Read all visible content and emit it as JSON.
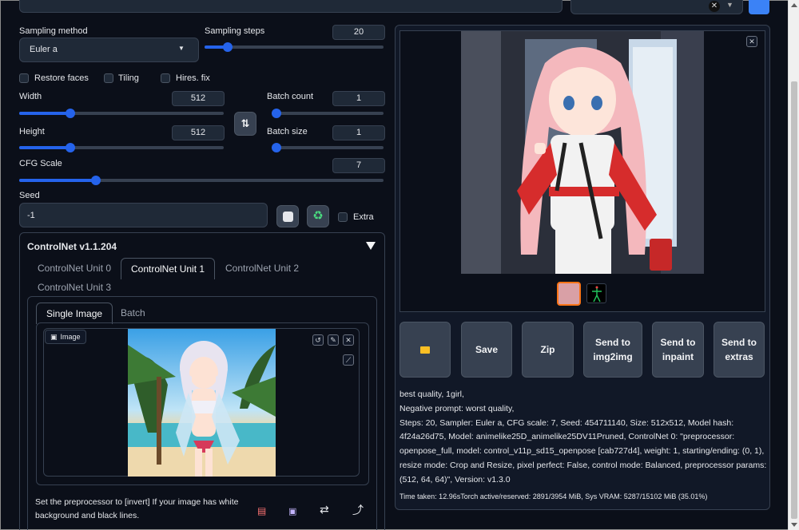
{
  "sampling": {
    "method_label": "Sampling method",
    "method_value": "Euler a",
    "steps_label": "Sampling steps",
    "steps_value": "20",
    "steps_fraction": 0.13
  },
  "checkboxes": {
    "restore_faces": "Restore faces",
    "tiling": "Tiling",
    "hires_fix": "Hires. fix"
  },
  "dims": {
    "width_label": "Width",
    "width_value": "512",
    "width_fraction": 0.25,
    "height_label": "Height",
    "height_value": "512",
    "height_fraction": 0.25,
    "swap_icon": "swap-vertical-icon"
  },
  "batch": {
    "count_label": "Batch count",
    "count_value": "1",
    "count_fraction": 0.0,
    "size_label": "Batch size",
    "size_value": "1",
    "size_fraction": 0.0
  },
  "cfg": {
    "label": "CFG Scale",
    "value": "7",
    "fraction": 0.21
  },
  "seed": {
    "label": "Seed",
    "value": "-1",
    "dice_icon": "dice-icon",
    "recycle_icon": "recycle-icon",
    "extra_label": "Extra"
  },
  "controlnet": {
    "title": "ControlNet v1.1.204",
    "units": [
      "ControlNet Unit 0",
      "ControlNet Unit 1",
      "ControlNet Unit 2",
      "ControlNet Unit 3"
    ],
    "active_unit": 1,
    "image_tabs": [
      "Single Image",
      "Batch"
    ],
    "image_label": "Image",
    "hint": "Set the preprocessor to [invert] If your image has white background and black lines."
  },
  "output": {
    "buttons": {
      "folder_icon": "folder-icon",
      "save": "Save",
      "zip": "Zip",
      "img2img": "Send to img2img",
      "inpaint": "Send to inpaint",
      "extras": "Send to extras"
    },
    "prompt": "best quality, 1girl,",
    "negative": "Negative prompt: worst quality,",
    "params": "Steps: 20, Sampler: Euler a, CFG scale: 7, Seed: 454711140, Size: 512x512, Model hash: 4f24a26d75, Model: animelike25D_animelike25DV11Pruned, ControlNet 0: \"preprocessor: openpose_full, model: control_v11p_sd15_openpose [cab727d4], weight: 1, starting/ending: (0, 1), resize mode: Crop and Resize, pixel perfect: False, control mode: Balanced, preprocessor params: (512, 64, 64)\", Version: v1.3.0",
    "time": "Time taken: 12.96sTorch active/reserved: 2891/3954 MiB, Sys VRAM: 5287/15102 MiB (35.01%)"
  },
  "colors": {
    "background": "#0b0f19",
    "accent": "#2563eb",
    "panel_border": "#374151",
    "thumb_selected": "#f97316"
  }
}
